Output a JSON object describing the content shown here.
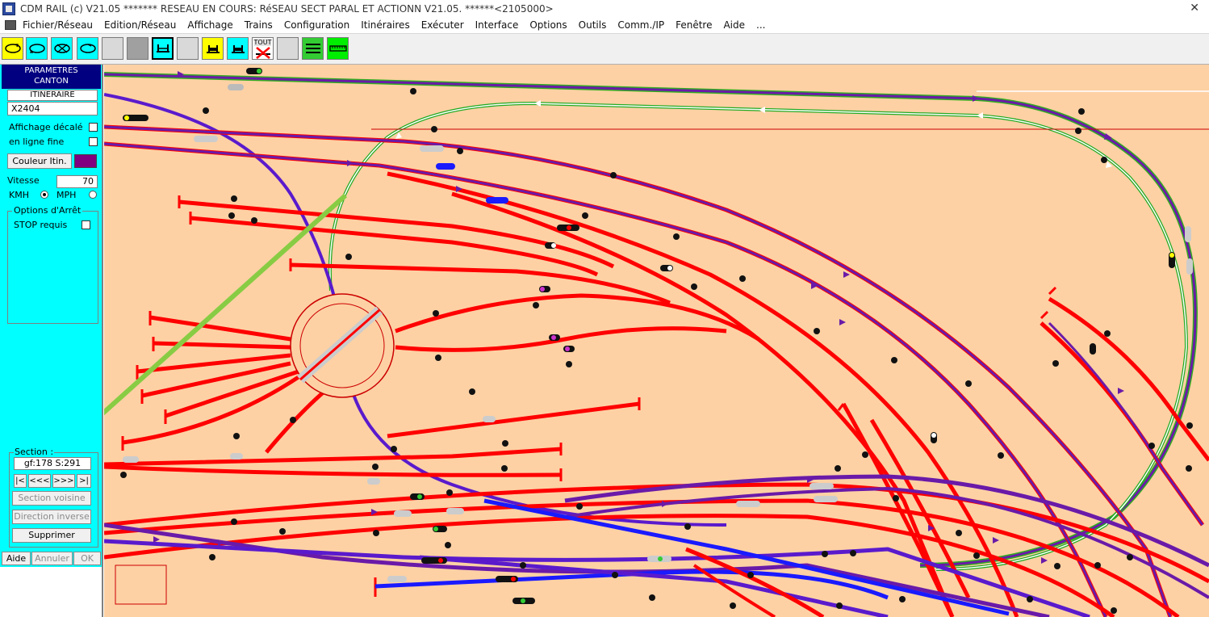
{
  "titlebar": {
    "text": "CDM RAIL (c) V21.05     ******* RESEAU EN COURS: RéSEAU SECT PARAL ET ACTIONN V21.05. ******<2105000>",
    "close_glyph": "✕"
  },
  "menu": [
    "Fichier/Réseau",
    "Edition/Réseau",
    "Affichage",
    "Trains",
    "Configuration",
    "Itinéraires",
    "Exécuter",
    "Interface",
    "Options",
    "Outils",
    "Comm./IP",
    "Fenêtre",
    "Aide",
    "..."
  ],
  "toolbar": {
    "tout_label": "TOUT",
    "icons": [
      "loop-icon",
      "loop-icon",
      "crossing-icon",
      "loop-icon",
      "blank-icon",
      "blank-icon",
      "route-icon",
      "blank-icon",
      "train-icon",
      "train-icon",
      "cancel-all-icon",
      "blank-icon",
      "list-icon",
      "ruler-icon"
    ]
  },
  "panel": {
    "title_line1": "PARAMETRES",
    "title_line2": "CANTON",
    "itineraire_label": "ITINERAIRE",
    "itineraire_value": "X2404",
    "affichage_decale": "Affichage décalé",
    "ligne_fine": "en ligne fine",
    "couleur_btn": "Couleur Itin.",
    "couleur_value": "#800080",
    "vitesse_label": "Vitesse",
    "vitesse_value": "70",
    "kmh": "KMH",
    "mph": "MPH",
    "options_arret": "Options d'Arrêt",
    "stop_requis": "STOP requis",
    "section_label": "Section :",
    "section_value": "gf:178 S:291",
    "nav_first": "|<",
    "nav_prev": "<<<",
    "nav_next": ">>>",
    "nav_last": ">|",
    "section_voisine": "Section voisine",
    "direction_inverse": "Direction inverse",
    "supprimer": "Supprimer",
    "aide": "Aide",
    "annuler": "Annuler",
    "ok": "OK"
  },
  "colors": {
    "panel_bg": "#00ffff",
    "canvas_bg": "#fdd1a4",
    "track_red": "#ff0000",
    "track_purple": "#6a1aa8",
    "track_blue": "#1a1aff",
    "route_green": "#33aa22",
    "route_purple": "#800080",
    "arrow_green": "#88cc44"
  }
}
